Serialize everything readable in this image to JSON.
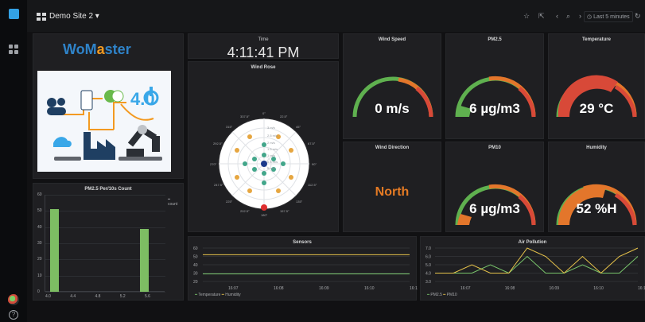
{
  "sidebar": {
    "logo": "grafana-logo",
    "items": [
      "dashboards-icon",
      "user-avatar",
      "help-icon"
    ]
  },
  "header": {
    "title": "Demo Site 2",
    "time_range": "Last 5 minutes"
  },
  "brand": {
    "title_blue": "WoM",
    "title_orange": "a",
    "title_rest": "ster",
    "image_text": "4.0"
  },
  "time_panel": {
    "label": "Time",
    "value": "4:11:41 PM"
  },
  "wind_rose": {
    "title": "Wind Rose",
    "directions": [
      "0°",
      "22.5°",
      "45°",
      "67.5°",
      "90°",
      "112.5°",
      "135°",
      "157.5°",
      "180°",
      "202.5°",
      "225°",
      "247.5°",
      "270°",
      "292.5°",
      "315°",
      "337.5°"
    ],
    "rings": [
      "3 m/s",
      "2.5 m/s",
      "2 m/s",
      "1.5 m/s",
      "1 m/s",
      "0.5 m/s",
      "0 m/s"
    ]
  },
  "gauges": [
    {
      "title": "Wind Speed",
      "value": "0 m/s"
    },
    {
      "title": "PM2.5",
      "value": "6 µg/m3"
    },
    {
      "title": "Temperature",
      "value": "29 °C"
    },
    {
      "title": "PM10",
      "value": "6 µg/m3"
    },
    {
      "title": "Humidity",
      "value": "52 %H"
    }
  ],
  "wind_direction": {
    "title": "Wind Direction",
    "value": "North"
  },
  "pm_count": {
    "title": "PM2.5 Per/10s Count",
    "legend": "count"
  },
  "sensors": {
    "title": "Sensors",
    "legend": [
      "Temperature",
      "Humidity"
    ],
    "y_ticks": [
      "60",
      "50",
      "40",
      "30",
      "20"
    ],
    "x_ticks": [
      "16:07",
      "16:08",
      "16:09",
      "16:10",
      "16:11"
    ]
  },
  "air_pollution": {
    "title": "Air Pollution",
    "legend": [
      "PM2.5",
      "PM10"
    ],
    "y_ticks": [
      "7.0",
      "6.0",
      "5.0",
      "4.0",
      "3.0"
    ],
    "x_ticks": [
      "16:07",
      "16:08",
      "16:09",
      "16:10",
      "16:11"
    ]
  },
  "chart_data": [
    {
      "type": "bar",
      "title": "PM2.5 Per/10s Count",
      "x": [
        4.0,
        5.2
      ],
      "values": [
        51,
        39
      ],
      "xticks": [
        "4.0",
        "4.4",
        "4.8",
        "5.2",
        "5.6"
      ],
      "ylim": [
        0,
        60
      ],
      "yticks": [
        "0",
        "10",
        "20",
        "30",
        "40",
        "50",
        "60"
      ],
      "series": [
        {
          "name": "count",
          "values": [
            51,
            39
          ]
        }
      ],
      "legend": "right"
    },
    {
      "type": "line",
      "title": "Sensors",
      "ylim": [
        20,
        60
      ],
      "series": [
        {
          "name": "Temperature",
          "values": [
            29,
            29,
            29,
            29,
            29
          ]
        },
        {
          "name": "Humidity",
          "values": [
            52,
            52,
            52,
            52,
            52
          ]
        }
      ],
      "categories": [
        "16:07",
        "16:08",
        "16:09",
        "16:10",
        "16:11"
      ]
    },
    {
      "type": "line",
      "title": "Air Pollution",
      "ylim": [
        3.0,
        7.0
      ],
      "series": [
        {
          "name": "PM2.5",
          "values": [
            4,
            4,
            4,
            5,
            4,
            6,
            4,
            4,
            5,
            4,
            4,
            6
          ]
        },
        {
          "name": "PM10",
          "values": [
            4,
            4,
            5,
            4,
            4,
            7,
            6,
            4,
            6,
            4,
            6,
            7
          ]
        }
      ],
      "categories": [
        "16:07",
        "16:08",
        "16:09",
        "16:10",
        "16:11"
      ]
    }
  ]
}
